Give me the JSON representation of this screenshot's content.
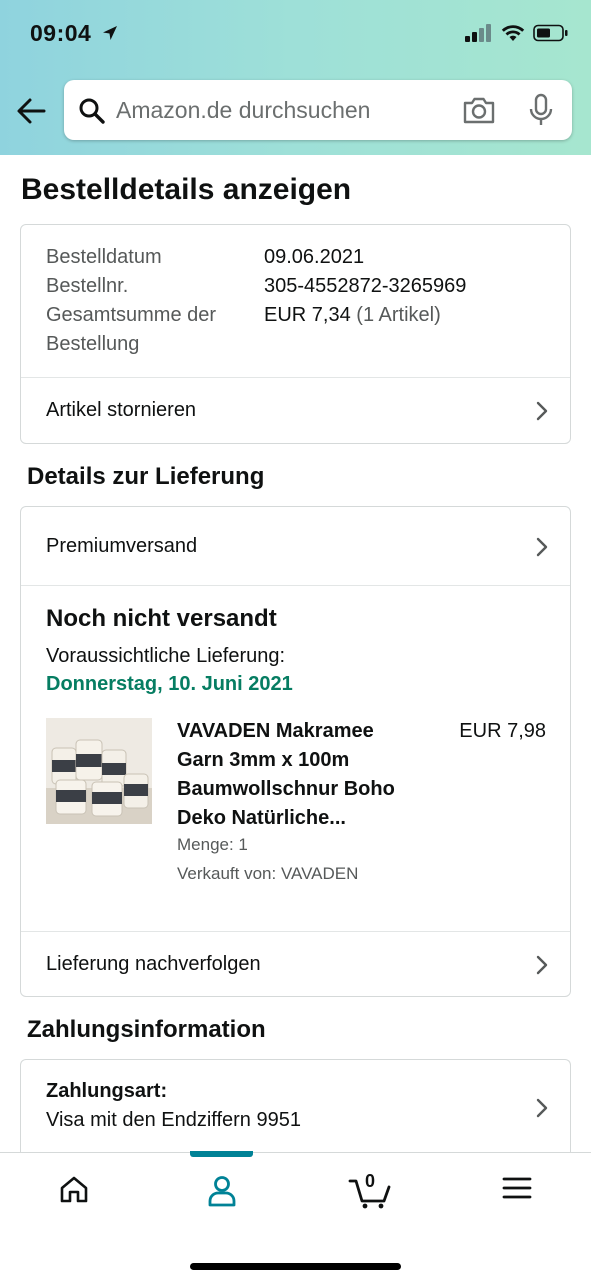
{
  "status_bar": {
    "time": "09:04"
  },
  "search": {
    "placeholder": "Amazon.de durchsuchen"
  },
  "page": {
    "title": "Bestelldetails anzeigen"
  },
  "order_summary": {
    "date_label": "Bestelldatum",
    "date_value": "09.06.2021",
    "number_label": "Bestellnr.",
    "number_value": "305-4552872-3265969",
    "total_label_line1": "Gesamtsumme der",
    "total_label_line2": "Bestellung",
    "total_value": "EUR 7,34",
    "total_items": "(1 Artikel)",
    "cancel_link": "Artikel stornieren"
  },
  "delivery": {
    "section_title": "Details zur Lieferung",
    "shipping_method": "Premiumversand",
    "status": "Noch nicht versandt",
    "expected_label": "Voraussichtliche Lieferung:",
    "expected_date": "Donnerstag, 10. Juni 2021",
    "product": {
      "title_lines": [
        "VAVADEN Makramee",
        "Garn 3mm x 100m",
        "Baumwollschnur Boho",
        "Deko Natürliche..."
      ],
      "price": "EUR 7,98",
      "quantity": "Menge: 1",
      "seller": "Verkauft von: VAVADEN"
    },
    "track_link": "Lieferung nachverfolgen"
  },
  "payment": {
    "section_title": "Zahlungsinformation",
    "method_label": "Zahlungsart:",
    "method_value": "Visa mit den Endziffern 9951"
  },
  "bottom_nav": {
    "items": [
      "home-icon",
      "account-icon",
      "cart-icon",
      "menu-icon"
    ],
    "active": "account-icon",
    "cart_count": "0"
  },
  "colors": {
    "accent": "#008296",
    "delivery_green": "#067d62",
    "header_gradient_start": "#8fd3de",
    "header_gradient_end": "#a6e6cf"
  }
}
